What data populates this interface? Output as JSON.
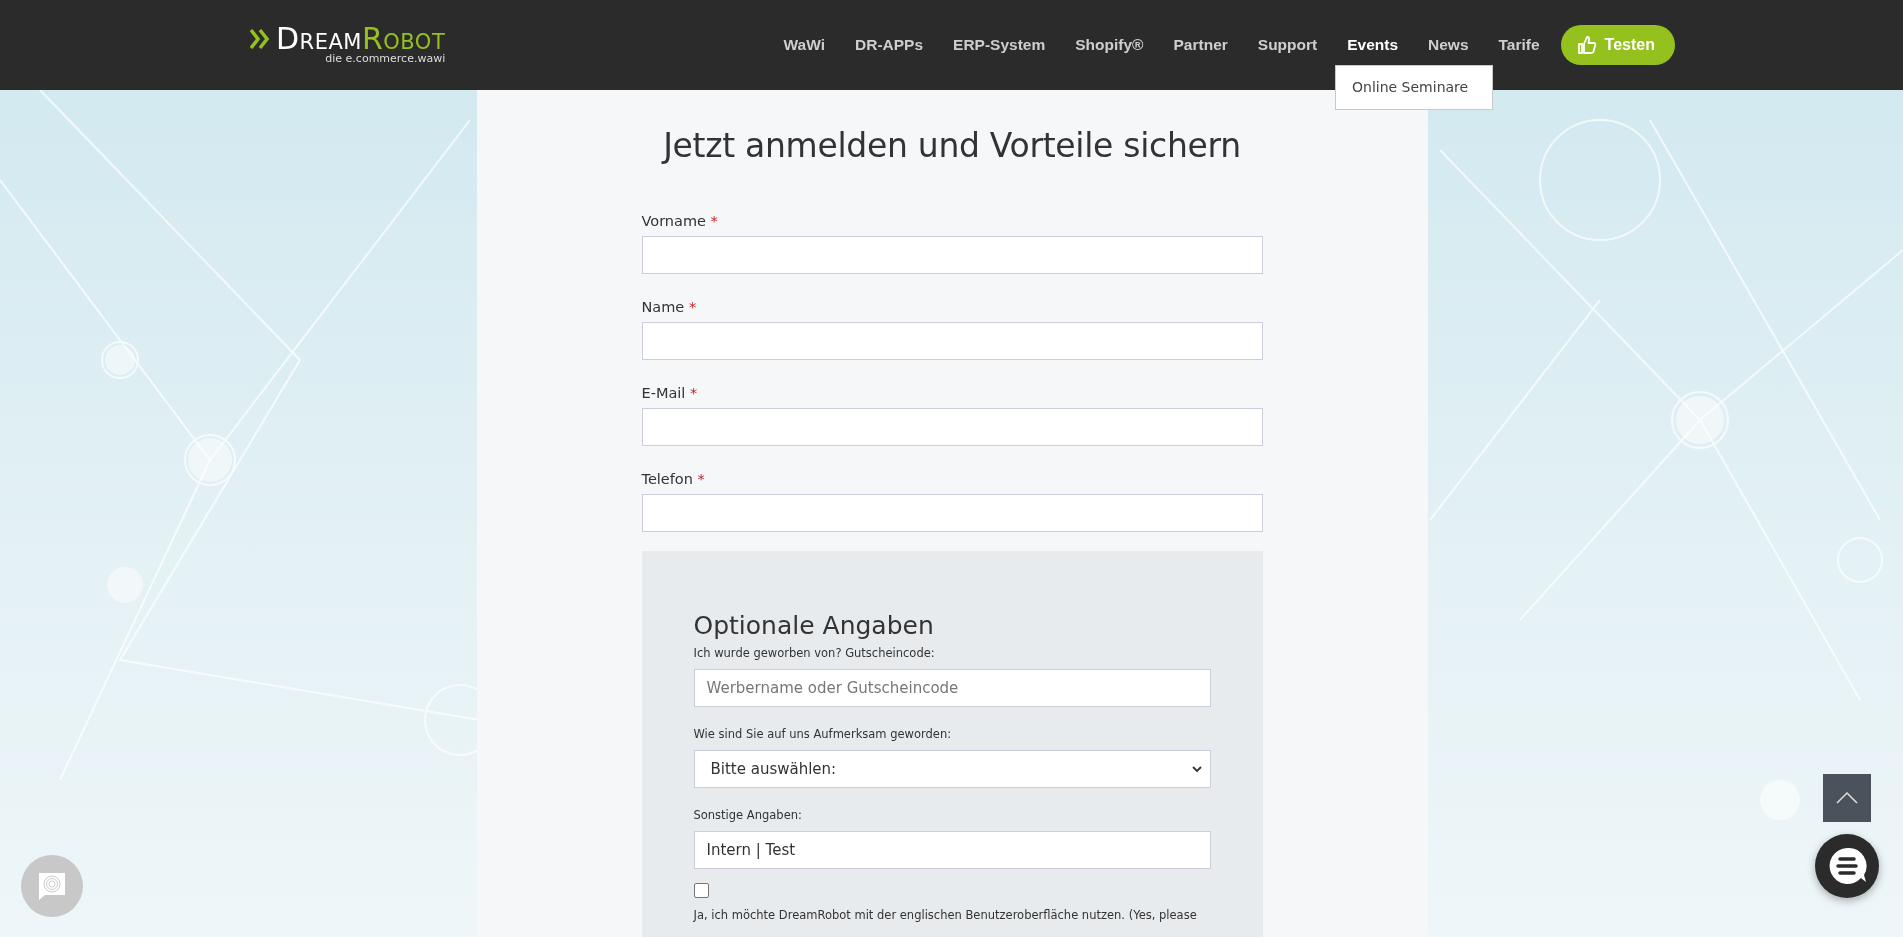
{
  "header": {
    "logo": {
      "name_first": "Dream",
      "name_second": "Robot",
      "tagline": "die e.commerce.wawi"
    },
    "nav": [
      {
        "label": "WaWi",
        "selected": false
      },
      {
        "label": "DR-APPs",
        "selected": false
      },
      {
        "label": "ERP-System",
        "selected": false
      },
      {
        "label": "Shopify®",
        "selected": false
      },
      {
        "label": "Partner",
        "selected": false
      },
      {
        "label": "Support",
        "selected": false
      },
      {
        "label": "Events",
        "selected": true
      },
      {
        "label": "News",
        "selected": false
      },
      {
        "label": "Tarife",
        "selected": false
      }
    ],
    "cta": {
      "label": "Testen"
    },
    "dropdown": {
      "items": [
        "Online Seminare"
      ]
    }
  },
  "form": {
    "title": "Jetzt anmelden und Vorteile sichern",
    "fields": [
      {
        "label": "Vorname",
        "required_mark": "*"
      },
      {
        "label": "Name",
        "required_mark": "*"
      },
      {
        "label": "E-Mail",
        "required_mark": "*"
      },
      {
        "label": "Telefon",
        "required_mark": "*"
      }
    ],
    "optional": {
      "heading": "Optionale Angaben",
      "fields": [
        {
          "kind": "text",
          "label": "Ich wurde geworben von? Gutscheincode:",
          "placeholder": "Werbername oder Gutscheincode"
        },
        {
          "kind": "select",
          "label": "Wie sind Sie auf uns Aufmerksam geworden:",
          "value": "Bitte auswählen:"
        },
        {
          "kind": "text",
          "label": "Sonstige Angaben:",
          "value": "Intern | Test"
        },
        {
          "kind": "checkbox",
          "checked": false,
          "label": "Ja, ich möchte DreamRobot mit der englischen Benutzeroberfläche nutzen. (Yes, please"
        }
      ]
    }
  }
}
